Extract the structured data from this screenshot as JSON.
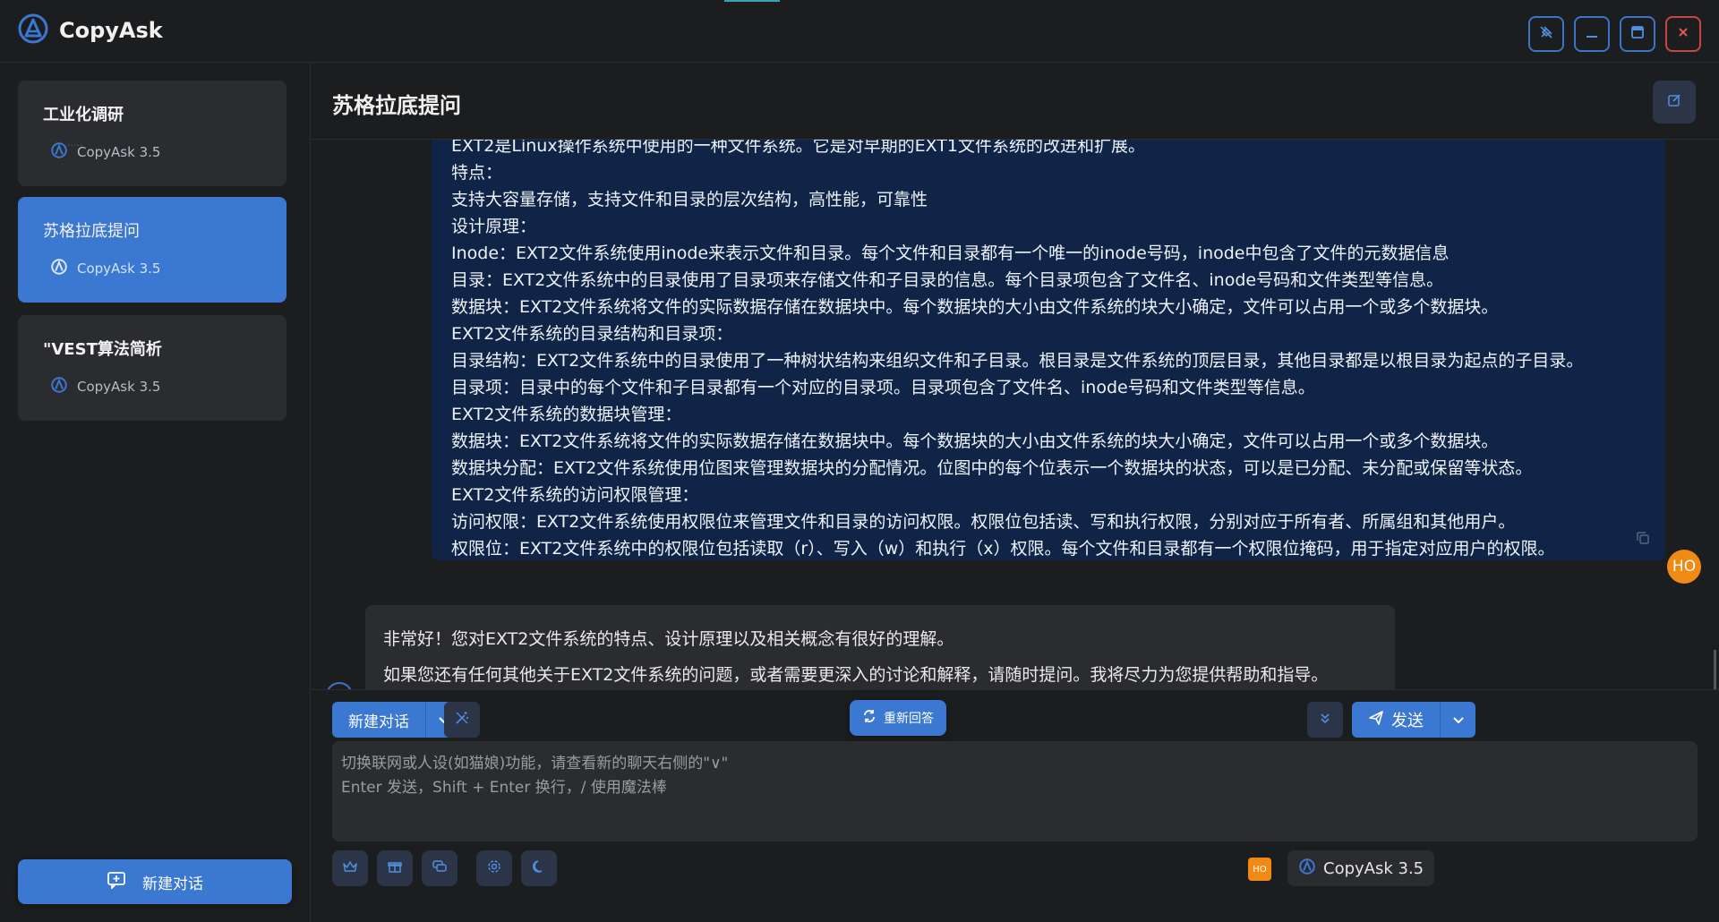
{
  "app": {
    "name": "CopyAsk"
  },
  "window_controls": [
    {
      "name": "pin-icon"
    },
    {
      "name": "minimize-icon"
    },
    {
      "name": "maximize-icon"
    },
    {
      "name": "close-icon"
    }
  ],
  "sidebar": {
    "ghost_text": "·····",
    "items": [
      {
        "title": "工业化调研",
        "model": "CopyAsk 3.5",
        "active": false
      },
      {
        "title": "苏格拉底提问",
        "model": "CopyAsk 3.5",
        "active": true
      },
      {
        "title": "\"VEST算法简析",
        "model": "CopyAsk 3.5",
        "active": false
      }
    ],
    "new_chat_label": "新建对话"
  },
  "chat": {
    "title": "苏格拉底提问",
    "user_message_lines": [
      "EXT2是Linux操作系统中使用的一种文件系统。它是对早期的EXT1文件系统的改进和扩展。",
      "特点：",
      "支持大容量存储，支持文件和目录的层次结构，高性能，可靠性",
      "设计原理：",
      "Inode：EXT2文件系统使用inode来表示文件和目录。每个文件和目录都有一个唯一的inode号码，inode中包含了文件的元数据信息",
      "目录：EXT2文件系统中的目录使用了目录项来存储文件和子目录的信息。每个目录项包含了文件名、inode号码和文件类型等信息。",
      "数据块：EXT2文件系统将文件的实际数据存储在数据块中。每个数据块的大小由文件系统的块大小确定，文件可以占用一个或多个数据块。",
      "EXT2文件系统的目录结构和目录项：",
      "目录结构：EXT2文件系统中的目录使用了一种树状结构来组织文件和子目录。根目录是文件系统的顶层目录，其他目录都是以根目录为起点的子目录。",
      "目录项：目录中的每个文件和子目录都有一个对应的目录项。目录项包含了文件名、inode号码和文件类型等信息。",
      "EXT2文件系统的数据块管理：",
      "数据块：EXT2文件系统将文件的实际数据存储在数据块中。每个数据块的大小由文件系统的块大小确定，文件可以占用一个或多个数据块。",
      "数据块分配：EXT2文件系统使用位图来管理数据块的分配情况。位图中的每个位表示一个数据块的状态，可以是已分配、未分配或保留等状态。",
      "EXT2文件系统的访问权限管理：",
      "访问权限：EXT2文件系统使用权限位来管理文件和目录的访问权限。权限位包括读、写和执行权限，分别对应于所有者、所属组和其他用户。",
      "权限位：EXT2文件系统中的权限位包括读取（r）、写入（w）和执行（x）权限。每个文件和目录都有一个权限位掩码，用于指定对应用户的权限。"
    ],
    "user_avatar": "HO",
    "bot_message_lines": [
      "非常好！您对EXT2文件系统的特点、设计原理以及相关概念有很好的理解。",
      "如果您还有任何其他关于EXT2文件系统的问题，或者需要更深入的讨论和解释，请随时提问。我将尽力为您提供帮助和指导。"
    ]
  },
  "input": {
    "new_chat_label": "新建对话",
    "regenerate_label": "重新回答",
    "send_label": "发送",
    "placeholder_line1": "切换联网或人设(如猫娘)功能，请查看新的聊天右侧的\"∨\"",
    "placeholder_line2": "Enter 发送，Shift + Enter 换行，/ 使用魔法棒",
    "user_chip": "HO",
    "model_label": "CopyAsk 3.5"
  },
  "colors": {
    "accent": "#3b78d2",
    "user_bubble": "#0f2446",
    "avatar": "#f08a14",
    "close": "#c94545"
  }
}
